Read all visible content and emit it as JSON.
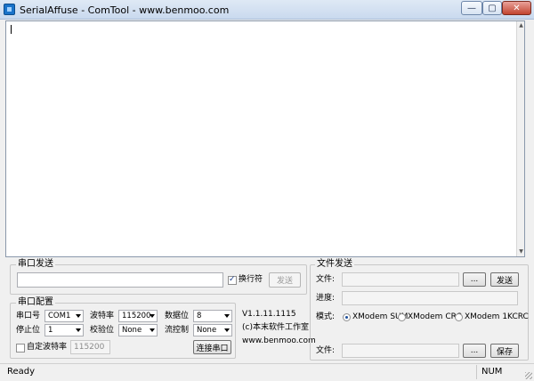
{
  "window": {
    "title": "SerialAffuse - ComTool - www.benmoo.com",
    "controls": {
      "minimize": "—",
      "maximize": "▢",
      "close": "✕"
    }
  },
  "serial_send": {
    "group_label": "串口发送",
    "input_value": "",
    "newline_label": "换行符",
    "newline_checked": true,
    "send_label": "发送"
  },
  "serial_config": {
    "group_label": "串口配置",
    "port_label": "串口号",
    "port_value": "COM1",
    "baud_label": "波特率",
    "baud_value": "115200",
    "databits_label": "数据位",
    "databits_value": "8",
    "stopbits_label": "停止位",
    "stopbits_value": "1",
    "parity_label": "校验位",
    "parity_value": "None",
    "flow_label": "流控制",
    "flow_value": "None",
    "custom_baud_label": "自定波特率",
    "custom_baud_value": "115200",
    "connect_label": "连接串口"
  },
  "about": {
    "version": "V1.1.11.1115",
    "copyright": "(c)本末软件工作室",
    "website": "www.benmoo.com"
  },
  "file_send": {
    "group_label": "文件发送",
    "file_label": "文件:",
    "file_value": "",
    "browse_label": "...",
    "send_label": "发送",
    "progress_label": "进度:",
    "mode_label": "模式:",
    "modes": [
      {
        "label": "XModem SUM",
        "checked": true
      },
      {
        "label": "XModem CRC",
        "checked": false
      },
      {
        "label": "XModem 1KCRC",
        "checked": false
      }
    ],
    "save_file_label": "文件:",
    "save_browse_label": "...",
    "save_label": "保存"
  },
  "status": {
    "left": "Ready",
    "right": "NUM"
  }
}
